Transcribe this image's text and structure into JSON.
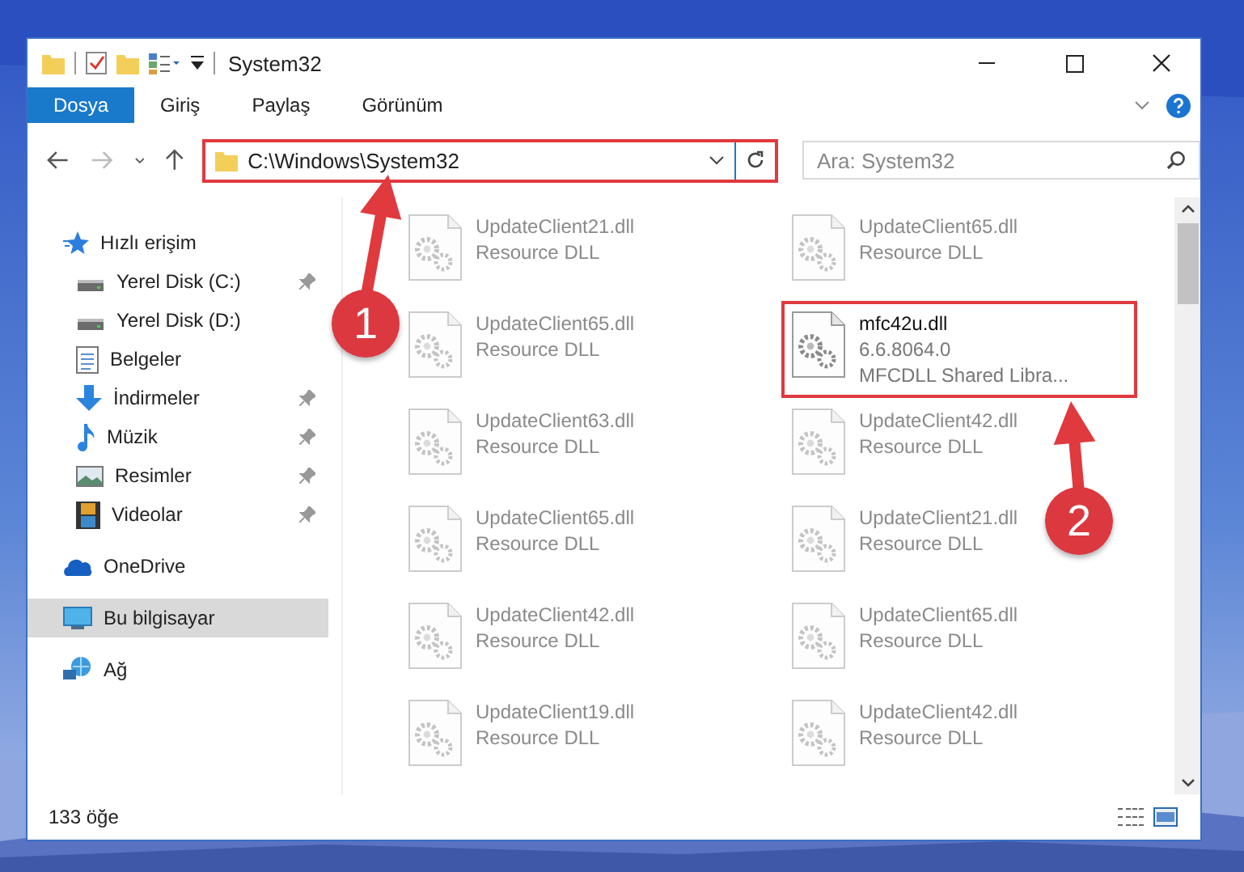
{
  "window": {
    "title": "System32"
  },
  "ribbon_tabs": [
    {
      "label": "Dosya",
      "selected": true
    },
    {
      "label": "Giriş",
      "selected": false
    },
    {
      "label": "Paylaş",
      "selected": false
    },
    {
      "label": "Görünüm",
      "selected": false
    }
  ],
  "address_bar": {
    "path": "C:\\Windows\\System32",
    "highlighted": true
  },
  "search": {
    "placeholder": "Ara: System32"
  },
  "sidebar": {
    "items": [
      {
        "label": "Hızlı erişim",
        "kind": "star",
        "selected": false,
        "children": [
          {
            "label": "Yerel Disk (C:)",
            "kind": "disk",
            "pinned": true,
            "selected": false
          },
          {
            "label": "Yerel Disk (D:)",
            "kind": "disk",
            "pinned": false,
            "selected": false
          },
          {
            "label": "Belgeler",
            "kind": "document",
            "pinned": false,
            "selected": false
          },
          {
            "label": "İndirmeler",
            "kind": "download",
            "pinned": true,
            "selected": false
          },
          {
            "label": "Müzik",
            "kind": "music",
            "pinned": true,
            "selected": false
          },
          {
            "label": "Resimler",
            "kind": "pictures",
            "pinned": true,
            "selected": false
          },
          {
            "label": "Videolar",
            "kind": "videos",
            "pinned": true,
            "selected": false
          }
        ]
      },
      {
        "label": "OneDrive",
        "kind": "cloud",
        "selected": false
      },
      {
        "label": "Bu bilgisayar",
        "kind": "computer",
        "selected": true
      },
      {
        "label": "Ağ",
        "kind": "network",
        "selected": false
      }
    ]
  },
  "files": [
    {
      "name": "UpdateClient21.dll",
      "lines": [
        "Resource DLL"
      ],
      "highlighted": false
    },
    {
      "name": "UpdateClient65.dll",
      "lines": [
        "Resource DLL"
      ],
      "highlighted": false
    },
    {
      "name": "UpdateClient65.dll",
      "lines": [
        "Resource DLL"
      ],
      "highlighted": false
    },
    {
      "name": "mfc42u.dll",
      "lines": [
        "6.6.8064.0",
        "MFCDLL Shared Libra..."
      ],
      "highlighted": true
    },
    {
      "name": "UpdateClient63.dll",
      "lines": [
        "Resource DLL"
      ],
      "highlighted": false
    },
    {
      "name": "UpdateClient42.dll",
      "lines": [
        "Resource DLL"
      ],
      "highlighted": false
    },
    {
      "name": "UpdateClient65.dll",
      "lines": [
        "Resource DLL"
      ],
      "highlighted": false
    },
    {
      "name": "UpdateClient21.dll",
      "lines": [
        "Resource DLL"
      ],
      "highlighted": false
    },
    {
      "name": "UpdateClient42.dll",
      "lines": [
        "Resource DLL"
      ],
      "highlighted": false
    },
    {
      "name": "UpdateClient65.dll",
      "lines": [
        "Resource DLL"
      ],
      "highlighted": false
    },
    {
      "name": "UpdateClient19.dll",
      "lines": [
        "Resource DLL"
      ],
      "highlighted": false
    },
    {
      "name": "UpdateClient42.dll",
      "lines": [
        "Resource DLL"
      ],
      "highlighted": false
    }
  ],
  "status_bar": {
    "item_count": "133 öğe"
  },
  "annotations": [
    {
      "number": "1"
    },
    {
      "number": "2"
    }
  ]
}
